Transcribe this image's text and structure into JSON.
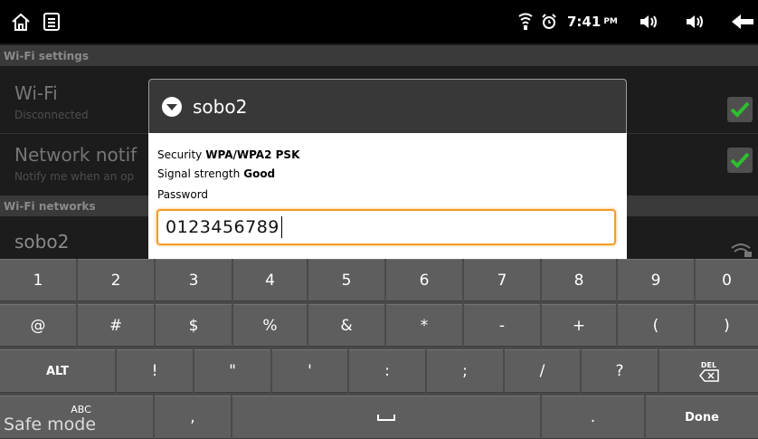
{
  "statusbar": {
    "time": "7:41",
    "ampm": "PM",
    "icons": [
      "home-icon",
      "menu-icon",
      "wifi-icon",
      "alarm-icon",
      "volume-down-icon",
      "volume-up-icon",
      "back-icon"
    ]
  },
  "settings": {
    "wifi_settings_header": "Wi-Fi settings",
    "wifi_title": "Wi-Fi",
    "wifi_summary": "Disconnected",
    "network_notif_title": "Network notif",
    "network_notif_summary": "Notify me when an op",
    "wifi_networks_header": "Wi-Fi networks",
    "network_name": "sobo2"
  },
  "dialog": {
    "title": "sobo2",
    "security_label": "Security",
    "security_value": "WPA/WPA2 PSK",
    "signal_label": "Signal strength",
    "signal_value": "Good",
    "password_label": "Password",
    "password_value": "0123456789"
  },
  "keyboard": {
    "row1": [
      "1",
      "2",
      "3",
      "4",
      "5",
      "6",
      "7",
      "8",
      "9",
      "0"
    ],
    "row2": [
      "@",
      "#",
      "$",
      "%",
      "&",
      "*",
      "-",
      "+",
      "(",
      ")"
    ],
    "row3": [
      "ALT",
      "!",
      "\"",
      "'",
      ":",
      ";",
      "/",
      "?",
      "DEL"
    ],
    "row4": [
      "ABC",
      ",",
      "␣",
      ".",
      "Done"
    ]
  },
  "safe_mode": "Safe mode",
  "colors": {
    "accent": "#f39c28",
    "check": "#2ebd2e"
  }
}
